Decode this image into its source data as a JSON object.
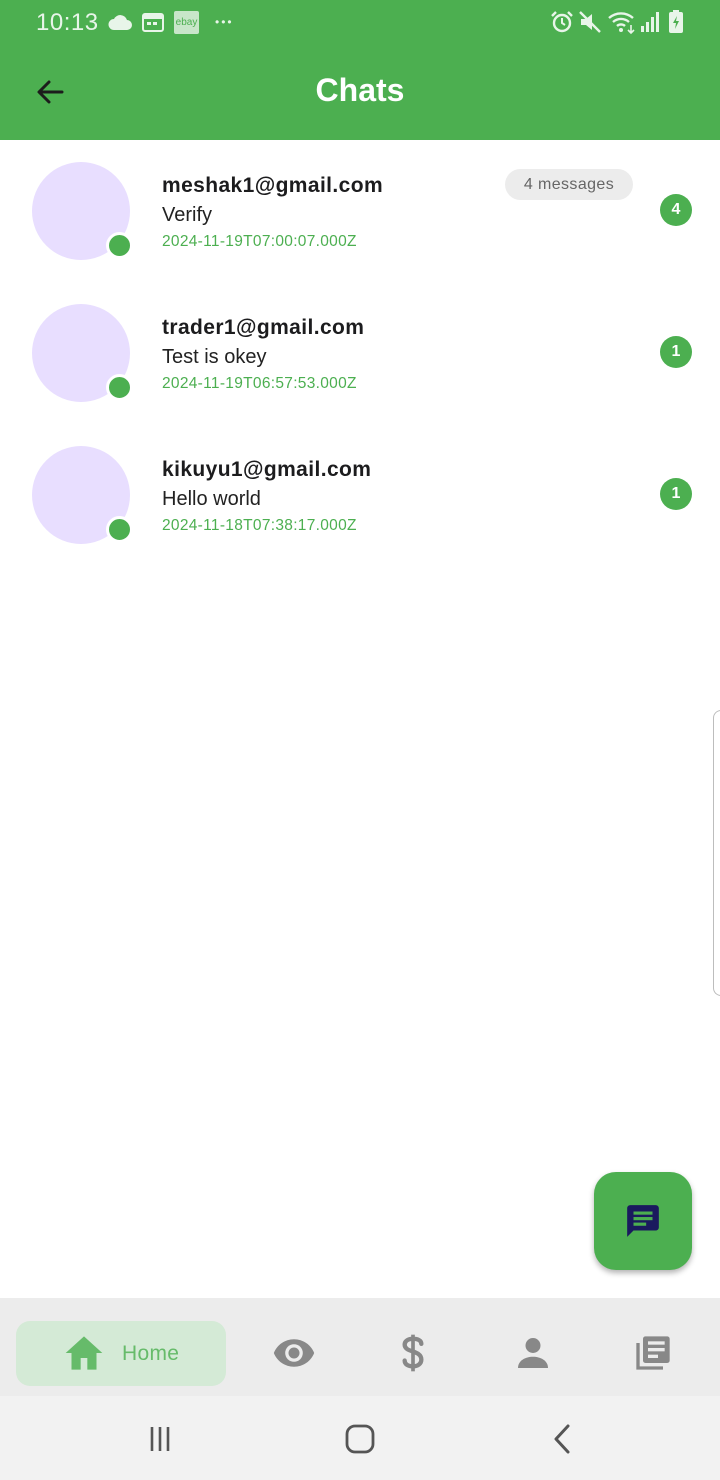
{
  "status_bar": {
    "time": "10:13",
    "ebay_label": "ebay",
    "more_dots": "•••",
    "icons": [
      "cloud-icon",
      "calendar-icon",
      "ebay-icon",
      "alarm-icon",
      "mute-icon",
      "wifi-icon",
      "signal-icon",
      "battery-charging-icon"
    ]
  },
  "app_bar": {
    "title": "Chats",
    "back_icon": "arrow-back-icon"
  },
  "chats": [
    {
      "email": "meshak1@gmail.com",
      "last_message": "Verify",
      "timestamp": "2024-11-19T07:00:07.000Z",
      "message_count_label": "4 messages",
      "unread": "4",
      "online": true
    },
    {
      "email": "trader1@gmail.com",
      "last_message": "Test is okey",
      "timestamp": "2024-11-19T06:57:53.000Z",
      "unread": "1",
      "online": true
    },
    {
      "email": "kikuyu1@gmail.com",
      "last_message": "Hello world",
      "timestamp": "2024-11-18T07:38:17.000Z",
      "unread": "1",
      "online": true
    }
  ],
  "fab": {
    "icon": "chat-icon"
  },
  "bottom_nav": {
    "items": [
      {
        "label": "Home",
        "icon": "home-icon",
        "active": true
      },
      {
        "icon": "eye-icon"
      },
      {
        "icon": "dollar-icon"
      },
      {
        "icon": "person-icon"
      },
      {
        "icon": "library-books-icon"
      }
    ]
  },
  "colors": {
    "primary": "#4caf50",
    "avatar": "#e8deff",
    "fab_icon": "#1a1a5e",
    "nav_active_bg": "#d4ead6",
    "nav_icon": "#888888"
  }
}
